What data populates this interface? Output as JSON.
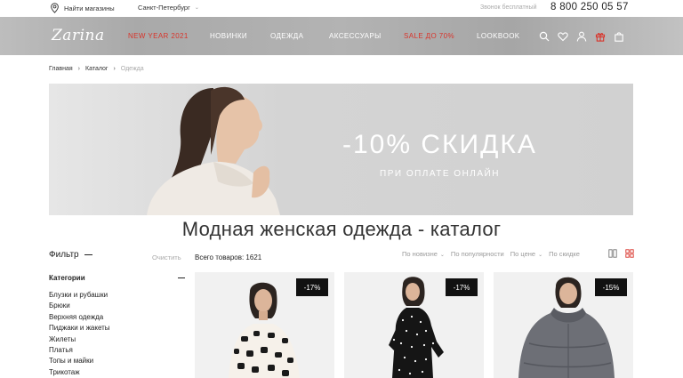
{
  "topbar": {
    "store_link": "Найти магазины",
    "city": "Санкт-Петербург",
    "free_call": "Звонок бесплатный",
    "phone": "8 800 250 05 57"
  },
  "nav": {
    "logo": "Zarina",
    "items": [
      {
        "label": "NEW YEAR 2021",
        "highlight": true
      },
      {
        "label": "НОВИНКИ",
        "highlight": false
      },
      {
        "label": "ОДЕЖДА",
        "highlight": false
      },
      {
        "label": "АКСЕССУАРЫ",
        "highlight": false
      },
      {
        "label": "SALE ДО 70%",
        "highlight": true
      },
      {
        "label": "LOOKBOOK",
        "highlight": false
      }
    ],
    "icons": [
      "search-icon",
      "heart-icon",
      "user-icon",
      "gift-icon",
      "bag-icon"
    ],
    "highlight_color": "#d9342b"
  },
  "breadcrumb": [
    "Главная",
    "Каталог",
    "Одежда"
  ],
  "banner": {
    "headline": "-10% СКИДКА",
    "subline": "ПРИ ОПЛАТЕ ОНЛАЙН"
  },
  "page_title": "Модная женская одежда - каталог",
  "filter": {
    "title": "Фильтр",
    "clear": "Очистить",
    "category_heading": "Категории",
    "categories": [
      "Блузки и рубашки",
      "Брюки",
      "Верхняя одежда",
      "Пиджаки и жакеты",
      "Жилеты",
      "Платья",
      "Топы и майки",
      "Трикотаж"
    ]
  },
  "listing": {
    "total": "Всего товаров: 1621",
    "sort_options": [
      "По новизне",
      "По популярности",
      "По цене",
      "По скидке"
    ]
  },
  "products": [
    {
      "discount": "-17%"
    },
    {
      "discount": "-17%"
    },
    {
      "discount": "-15%"
    }
  ]
}
